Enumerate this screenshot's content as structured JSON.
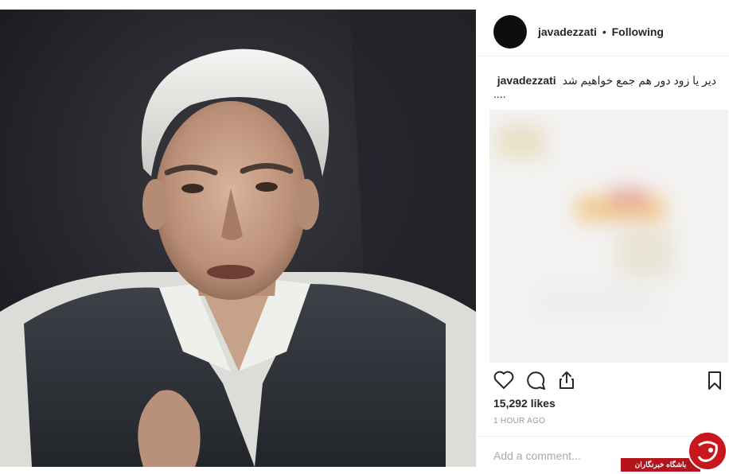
{
  "post": {
    "username": "javadezzati",
    "separator": "•",
    "follow_status": "Following",
    "caption": "دیر یا زود دور هم جمع خواهیم شد",
    "caption_more": "....",
    "likes": "15,292 likes",
    "time": "1 HOUR AGO",
    "comment_placeholder": "Add a comment..."
  },
  "icons": {
    "like": "heart-icon",
    "comment": "comment-icon",
    "share": "share-icon",
    "save": "bookmark-icon"
  },
  "watermark": {
    "text": "باشگاه خبرنگاران"
  },
  "colors": {
    "text": "#262626",
    "muted": "#999999",
    "divider": "#efefef",
    "watermark_red": "#b3151b"
  }
}
